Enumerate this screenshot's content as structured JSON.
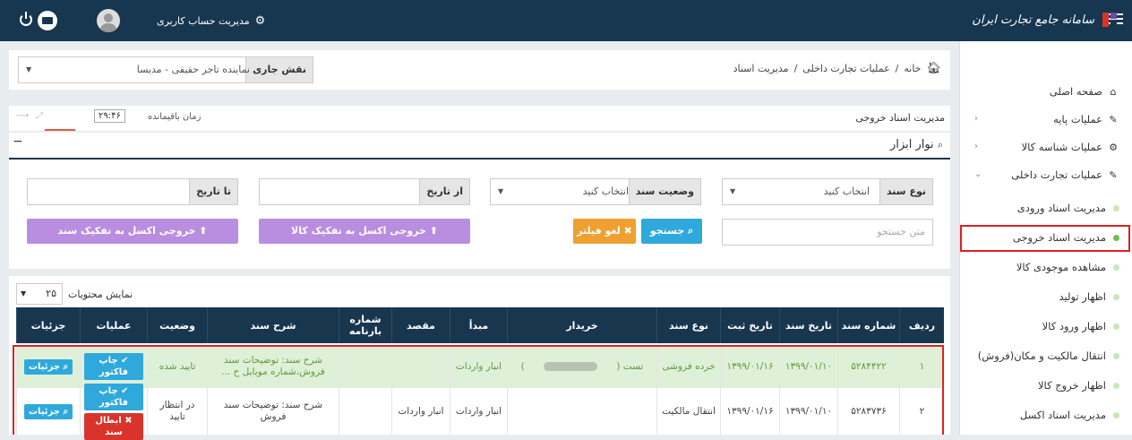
{
  "topbar": {
    "logo_text": "سامانه جامع تجارت ایران",
    "account_label": "مدیریت حساب کاربری",
    "menu_icon": "hamburger-icon",
    "power_icon": "power-icon",
    "mail_icon": "envelope-icon"
  },
  "breadcrumb": {
    "home": "خانه",
    "sep": "/",
    "b1": "عملیات تجارت داخلی",
    "b2": "مدیریت اسناد"
  },
  "role": {
    "label": "نقش جاری",
    "value": "نماینده تاجر حقیقی - مدیسا"
  },
  "page": {
    "title": "مدیریت اسناد خروجی",
    "timer_label": "زمان باقیمانده",
    "timer_value": "۲۹:۴۶"
  },
  "toolbar": {
    "title": "نوار ابزار",
    "doc_type_label": "نوع سند",
    "doc_type_value": "انتخاب کنید",
    "doc_status_label": "وضعیت سند",
    "doc_status_value": "انتخاب کنید",
    "from_date_label": "از تاریخ",
    "to_date_label": "تا تاریخ",
    "search_placeholder": "متن جستجو",
    "search_btn": "جستجو",
    "cancel_filter_btn": "لغو فیلتر",
    "excel_goods_btn": "خروجی اکسل به تفکیک کالا",
    "excel_doc_btn": "خروجی اکسل به تفکیک سند"
  },
  "table": {
    "show_label": "نمایش محتویات",
    "page_size": "۲۵",
    "headers": [
      "ردیف",
      "شماره سند",
      "تاریخ سند",
      "تاریخ ثبت",
      "نوع سند",
      "خریدار",
      "مبدأ",
      "مقصد",
      "شماره بارنامه",
      "شرح سند",
      "وضعیت",
      "عملیات",
      "جزئیات"
    ],
    "rows": [
      {
        "idx": "۱",
        "doc_no": "۵۲۸۴۴۲۲",
        "doc_date": "۱۳۹۹/۰۱/۱۰",
        "reg_date": "۱۳۹۹/۰۱/۱۶",
        "type": "خرده فروشی",
        "buyer": "تست (",
        "buyer_end": ")",
        "origin": "انبار واردات",
        "dest": "",
        "waybill": "",
        "desc": "شرح سند: توضیحات سند فروش،شماره موبایل خ ...",
        "status": "تایید شده",
        "op1": "چاپ فاکتور",
        "details": "جزئیات"
      },
      {
        "idx": "۲",
        "doc_no": "۵۲۸۳۷۳۶",
        "doc_date": "۱۳۹۹/۰۱/۱۰",
        "reg_date": "۱۳۹۹/۰۱/۱۶",
        "type": "انتقال مالکیت",
        "buyer": "",
        "buyer_end": "",
        "origin": "انبار واردات",
        "dest": "انبار واردات",
        "waybill": "",
        "desc": "شرح سند: توضیحات سند فروش",
        "status": "در انتظار تایید",
        "op1": "چاپ فاکتور",
        "op2": "ابطال سند",
        "details": "جزئیات"
      }
    ]
  },
  "sidebar": {
    "items": [
      {
        "label": "صفحه اصلی",
        "icon": "home-icon"
      },
      {
        "label": "عملیات پایه",
        "icon": "edit-icon"
      },
      {
        "label": "عملیات شناسه کالا",
        "icon": "cogs-icon"
      },
      {
        "label": "عملیات تجارت داخلی",
        "icon": "edit-icon"
      }
    ],
    "subitems": [
      "مدیریت اسناد ورودی",
      "مدیریت اسناد خروجی",
      "مشاهده موجودی کالا",
      "اظهار تولید",
      "اظهار ورود کالا",
      "انتقال مالکیت و مکان(فروش)",
      "اظهار خروج کالا",
      "مدیریت اسناد اکسل"
    ]
  },
  "colors": {
    "navbar": "#17364f",
    "sidebar_active": "#6cc04a",
    "search_btn": "#2fa9dc",
    "filter_btn": "#f0a030",
    "excel_btn": "#b98ee0",
    "highlight": "#e02020"
  }
}
